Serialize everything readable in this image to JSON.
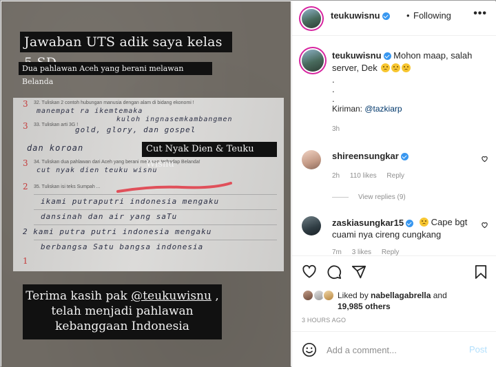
{
  "image": {
    "title": "Jawaban UTS adik saya kelas 5 SD",
    "subtitle": "Dua pahlawan Aceh yang berani melawan Belanda",
    "names_label": "Cut Nyak Dien & Teuku Wisnu",
    "thanks_line1_prefix": "Terima kasih pak ",
    "thanks_mention": "@teukuwisnu",
    "thanks_line1_suffix": " ,",
    "thanks_line2": "telah menjadi pahlawan",
    "thanks_line3": "kebanggaan Indonesia",
    "paper": {
      "q32": "32. Tuliskan 2 contoh hubungan manusia dengan alam di bidang ekonomi !",
      "q33": "33. Tuliskan arti 3G !",
      "q34": "34. Tuliskan dua pahlawan dari Aceh yang berani melawan terhadap Belanda!",
      "q35": "35. Tuliskan isi teks Sumpah ...",
      "a32": "manempat ra ikemtemaka",
      "a32b": "kuloh ingnasemkambangmen",
      "a33": "gold, glory, dan gospel",
      "a33b": "dan koroan",
      "a34": "cut nyak dien teuku wisnu",
      "a35a": "ikami putraputri indonesia mengaku",
      "a35b": "dansinah dan air yang saTu",
      "a35c": "2 kami putra putri indonesia mengaku",
      "a35d": "berbangsa Satu bangsa indonesia",
      "mark3a": "3",
      "mark3b": "3",
      "mark3c": "3",
      "mark2": "2",
      "mark1": "1"
    }
  },
  "header": {
    "username": "teukuwisnu",
    "separator": "•",
    "following": "Following",
    "more": "•••"
  },
  "caption": {
    "username": "teukuwisnu",
    "text": "Mohon maap, salah server, Dek",
    "dots": [
      ".",
      ".",
      "."
    ],
    "credit_prefix": "Kiriman: ",
    "credit_link": "@tazkiarp",
    "time": "3h"
  },
  "comments": [
    {
      "username": "shireensungkar",
      "text": "",
      "time": "2h",
      "likes": "110 likes",
      "reply": "Reply",
      "view_replies": "View replies (9)"
    },
    {
      "username": "zaskiasungkar15",
      "text": "Cape bgt cuami nya cireng cungkang",
      "time": "7m",
      "likes": "3 likes",
      "reply": "Reply"
    }
  ],
  "likes": {
    "prefix": "Liked by ",
    "user": "nabellagabrella",
    "middle": " and",
    "count": "19,985 others",
    "ago": "3 HOURS AGO"
  },
  "add_comment": {
    "placeholder": "Add a comment...",
    "post": "Post"
  },
  "colors": {
    "verified": "#3897f0",
    "story_ring": "#d6249f",
    "link": "#00376b",
    "post_disabled": "#b2dffc"
  },
  "icons": [
    "heart-icon",
    "comment-icon",
    "share-icon",
    "bookmark-icon",
    "smiley-icon",
    "verified-icon"
  ]
}
